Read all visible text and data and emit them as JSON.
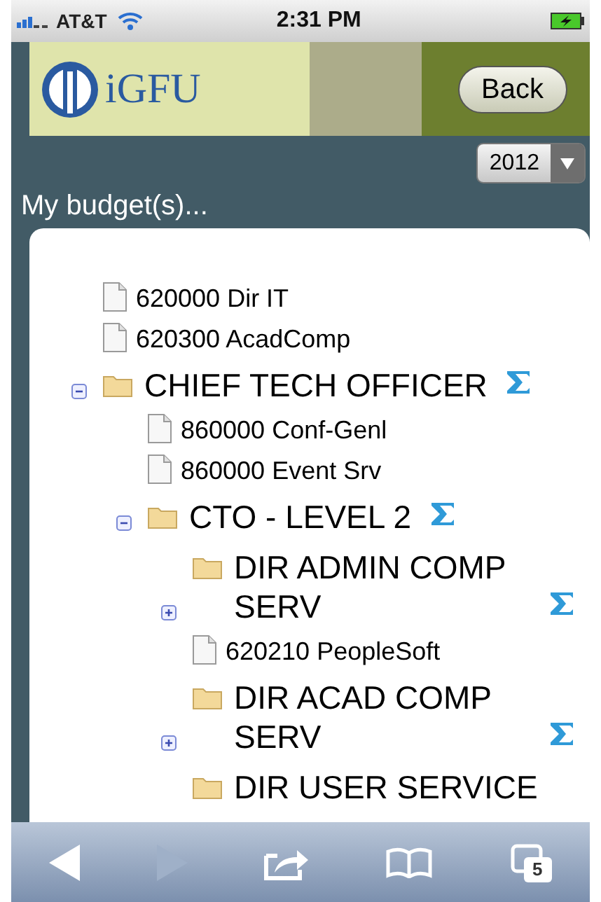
{
  "status_bar": {
    "carrier": "AT&T",
    "time": "2:31 PM"
  },
  "header": {
    "logo_text": "iGFU",
    "back_button": "Back"
  },
  "year_select": {
    "value": "2012"
  },
  "heading": "My budget(s)...",
  "tree": [
    {
      "kind": "doc",
      "label": "620000 Dir IT"
    },
    {
      "kind": "doc",
      "label": "620300 AcadComp"
    },
    {
      "kind": "folder",
      "label": "CHIEF TECH OFFICER",
      "expanded": true,
      "summary": true,
      "children": [
        {
          "kind": "doc",
          "label": "860000 Conf-Genl"
        },
        {
          "kind": "doc",
          "label": "860000 Event Srv"
        },
        {
          "kind": "folder",
          "label": "CTO - LEVEL 2",
          "expanded": true,
          "summary": true,
          "children": [
            {
              "kind": "folder",
              "label": "DIR ADMIN COMP SERV",
              "expanded": false,
              "summary": true
            },
            {
              "kind": "doc",
              "label": "620210 PeopleSoft"
            },
            {
              "kind": "folder",
              "label": "DIR ACAD COMP SERV",
              "expanded": false,
              "summary": true
            },
            {
              "kind": "folder",
              "label": "DIR USER SERVICE",
              "summary": false
            }
          ]
        }
      ]
    }
  ],
  "toolbar": {
    "tab_count": "5"
  }
}
